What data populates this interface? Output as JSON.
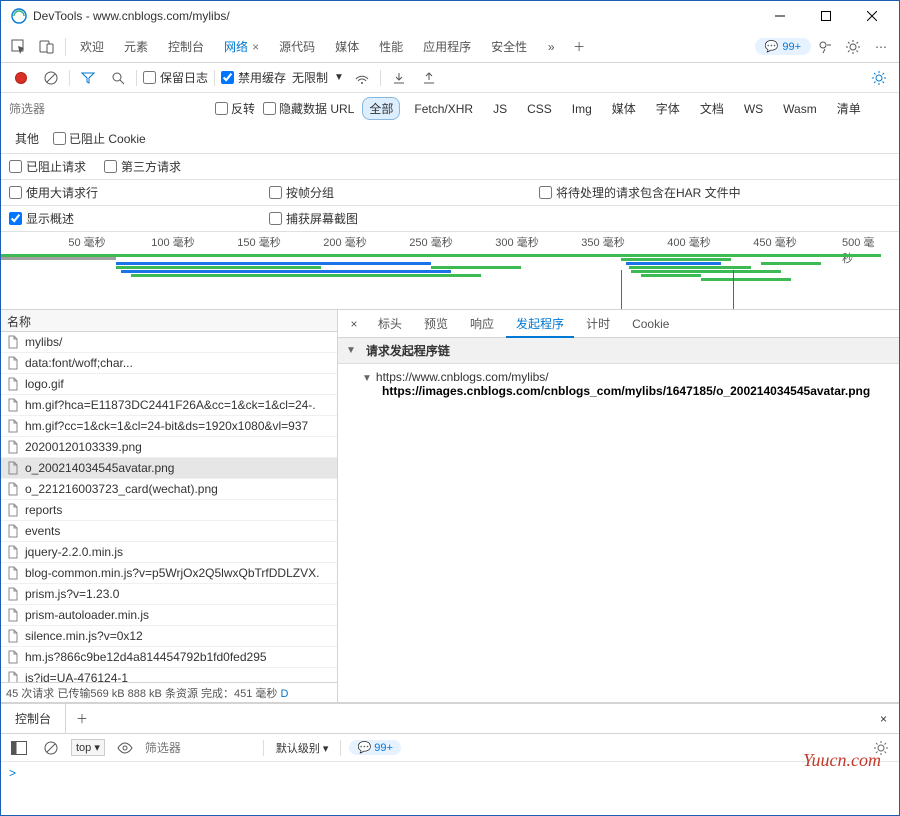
{
  "title": "DevTools - www.cnblogs.com/mylibs/",
  "mainTabs": {
    "t0": "欢迎",
    "t1": "元素",
    "t2": "控制台",
    "t3": "网络",
    "t4": "源代码",
    "t5": "媒体",
    "t6": "性能",
    "t7": "应用程序",
    "t8": "安全性"
  },
  "issuesPill": "99+",
  "netToolbar": {
    "preserve": "保留日志",
    "disableCache": "禁用缓存",
    "throttle": "无限制"
  },
  "filterPlaceholder": "筛选器",
  "filterOpts": {
    "invert": "反转",
    "hideData": "隐藏数据 URL"
  },
  "typeChips": {
    "all": "全部",
    "fetch": "Fetch/XHR",
    "js": "JS",
    "css": "CSS",
    "img": "Img",
    "media": "媒体",
    "font": "字体",
    "doc": "文档",
    "ws": "WS",
    "wasm": "Wasm",
    "manifest": "清单",
    "other": "其他"
  },
  "cookieBlocked": "已阻止 Cookie",
  "blockedReq": "已阻止请求",
  "thirdParty": "第三方请求",
  "opts": {
    "largeRows": "使用大请求行",
    "groupFrame": "按帧分组",
    "includeHar": "将待处理的请求包含在HAR 文件中",
    "overview": "显示概述",
    "screenshots": "捕获屏幕截图"
  },
  "ticks": [
    "50 毫秒",
    "100 毫秒",
    "150 毫秒",
    "200 毫秒",
    "250 毫秒",
    "300 毫秒",
    "350 毫秒",
    "400 毫秒",
    "450 毫秒",
    "500 毫秒"
  ],
  "nameHeader": "名称",
  "requests": [
    "mylibs/",
    "data:font/woff;char...",
    "logo.gif",
    "hm.gif?hca=E11873DC2441F26A&cc=1&ck=1&cl=24-.",
    "hm.gif?cc=1&ck=1&cl=24-bit&ds=1920x1080&vl=937",
    "20200120103339.png",
    "o_200214034545avatar.png",
    "o_221216003723_card(wechat).png",
    "reports",
    "events",
    "jquery-2.2.0.min.js",
    "blog-common.min.js?v=p5WrjOx2Q5lwxQbTrfDDLZVX.",
    "prism.js?v=1.23.0",
    "prism-autoloader.min.js",
    "silence.min.js?v=0x12",
    "hm.js?866c9be12d4a814454792b1fd0fed295",
    "js?id=UA-476124-1"
  ],
  "selectedIndex": 6,
  "statusBar": {
    "text": "45 次请求  已传输569 kB  888 kB 条资源  完成：451 毫秒 ",
    "more": "D"
  },
  "detailTabs": {
    "headers": "标头",
    "preview": "预览",
    "response": "响应",
    "initiator": "发起程序",
    "timing": "计时",
    "cookies": "Cookie"
  },
  "initiatorSection": "请求发起程序链",
  "chain": {
    "l1": "https://www.cnblogs.com/mylibs/",
    "l2": "https://images.cnblogs.com/cnblogs_com/mylibs/1647185/o_200214034545avatar.png"
  },
  "drawer": {
    "tab": "控制台",
    "context": "top",
    "filterPh": "筛选器",
    "level": "默认级别",
    "issues": "99+",
    "prompt": ">"
  },
  "watermark": "Yuucn.com"
}
